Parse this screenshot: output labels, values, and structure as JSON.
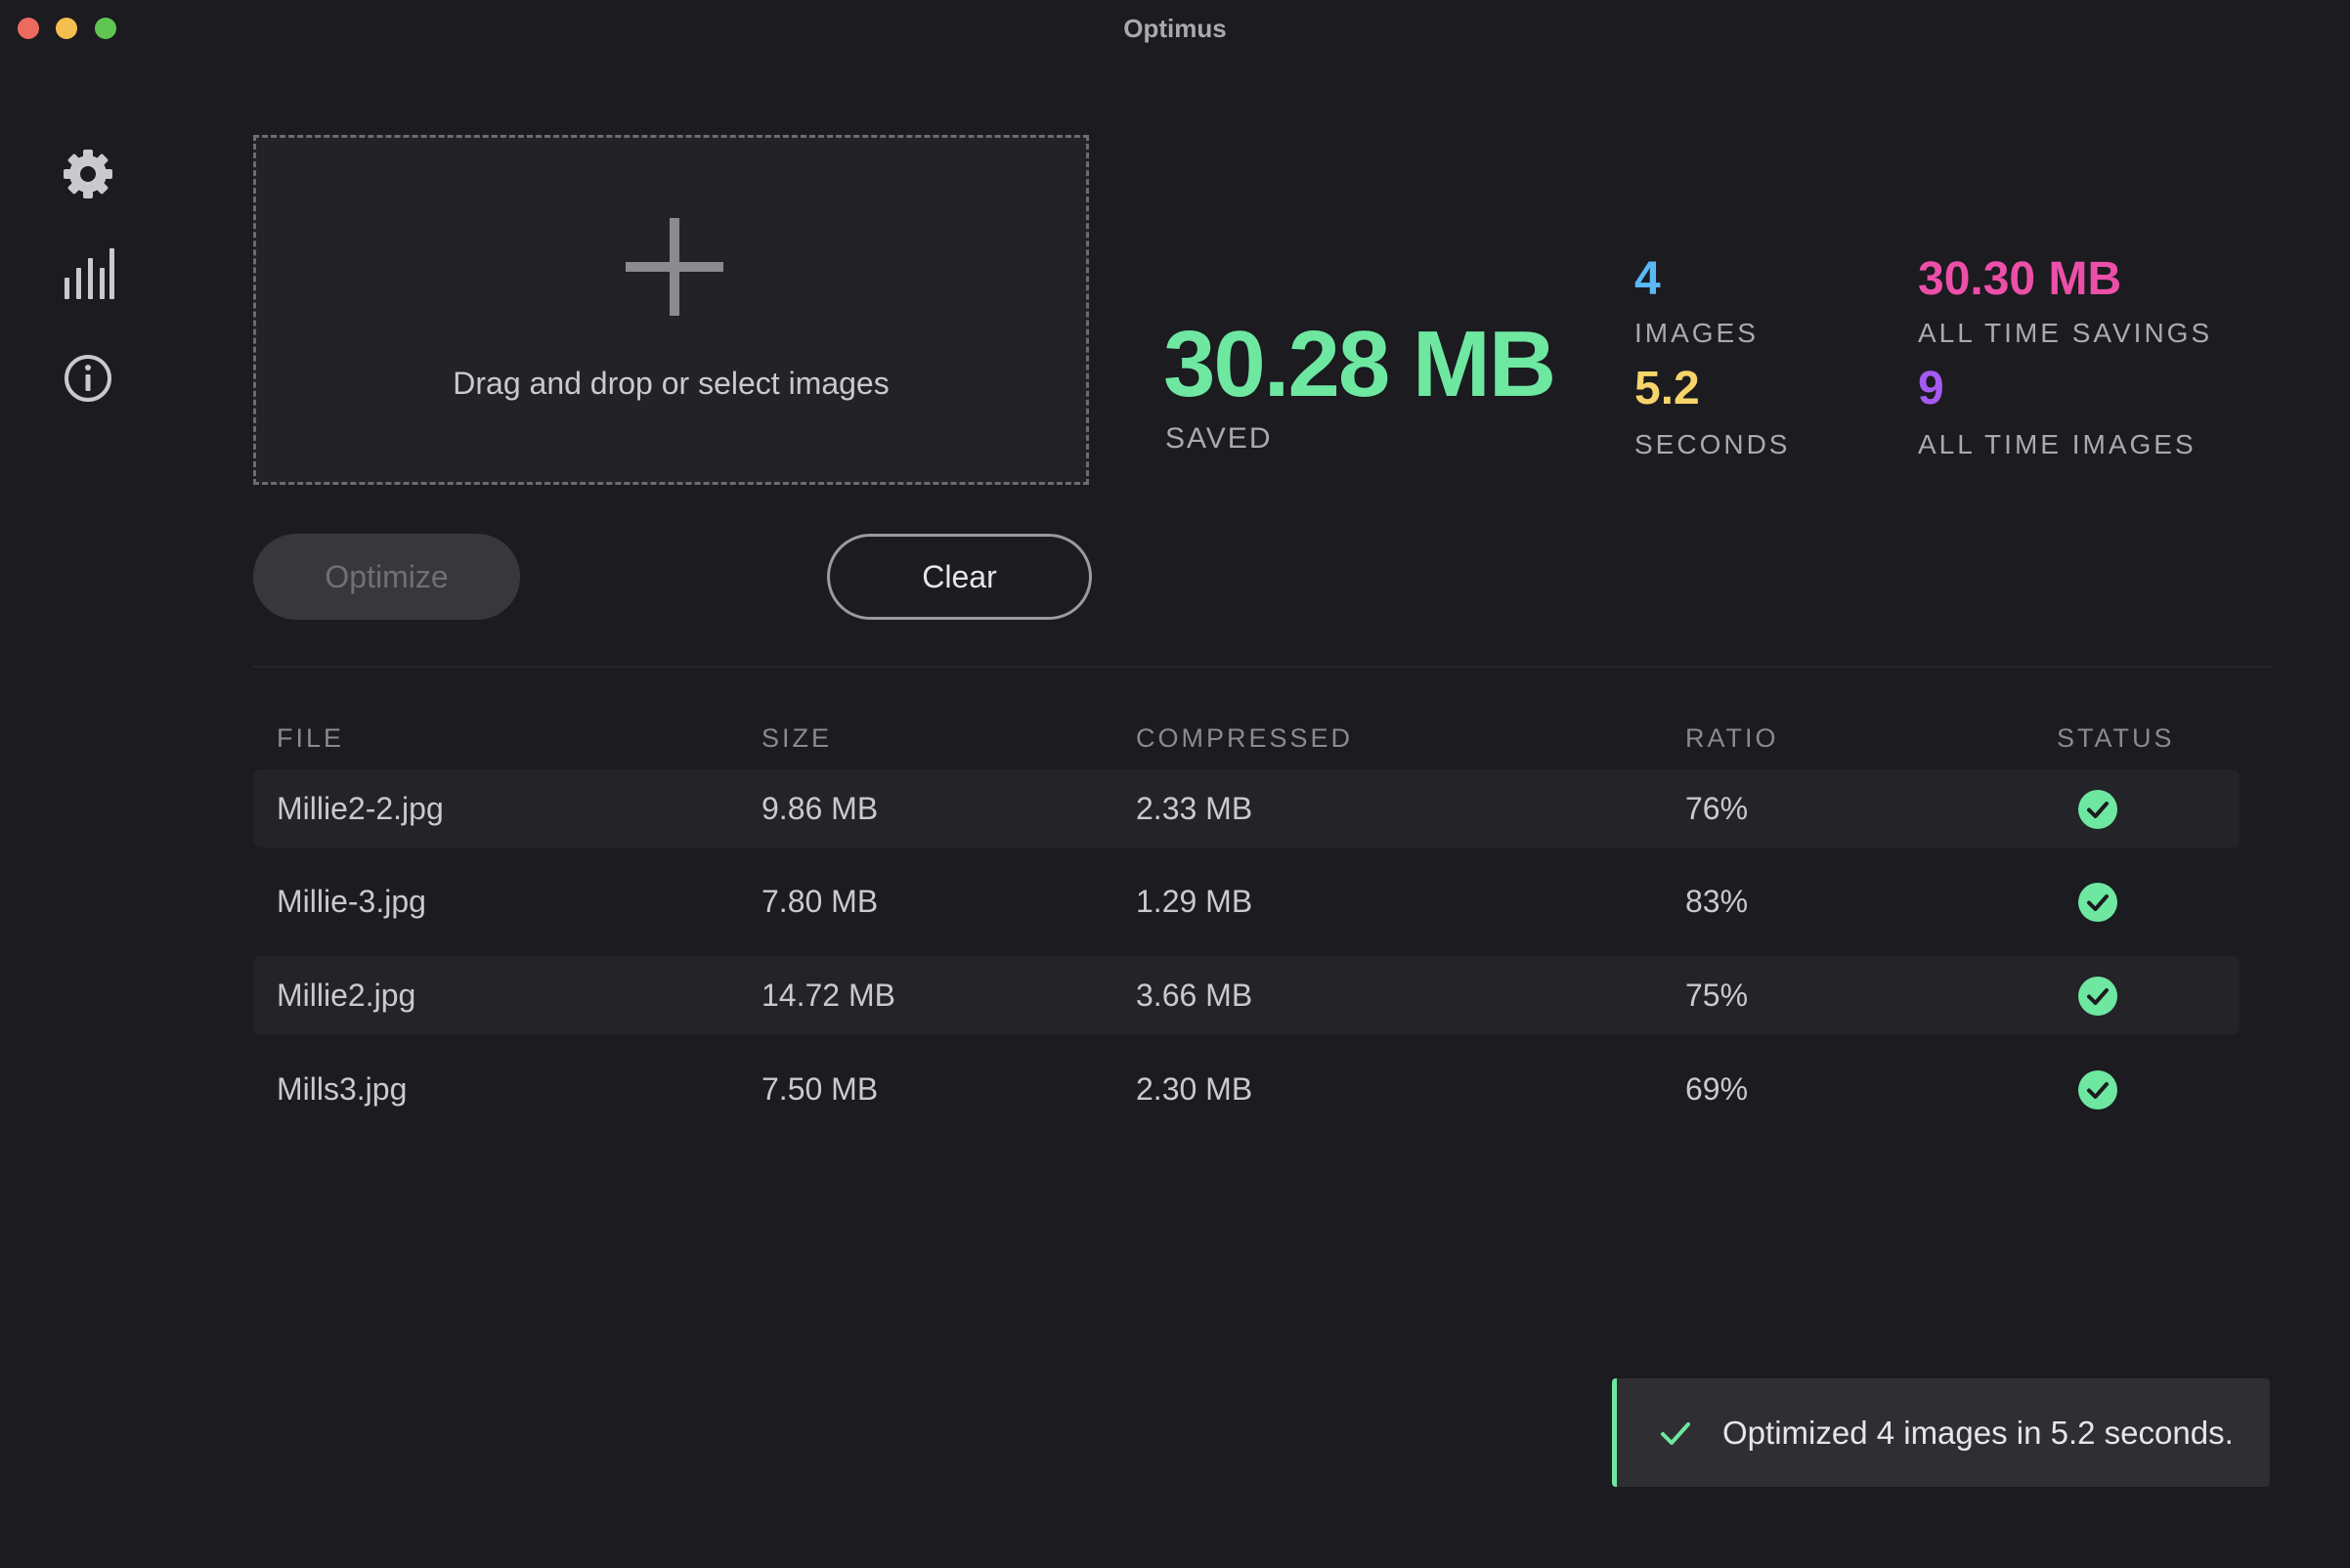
{
  "window": {
    "title": "Optimus"
  },
  "sidebar": {
    "items": [
      {
        "name": "settings",
        "icon": "gear-icon"
      },
      {
        "name": "stats",
        "icon": "bar-chart-icon"
      },
      {
        "name": "about",
        "icon": "info-icon"
      }
    ]
  },
  "dropzone": {
    "text": "Drag and drop or select images"
  },
  "actions": {
    "optimize_label": "Optimize",
    "clear_label": "Clear"
  },
  "stats": {
    "saved_value": "30.28 MB",
    "saved_label": "SAVED",
    "images_value": "4",
    "images_label": "IMAGES",
    "seconds_value": "5.2",
    "seconds_label": "SECONDS",
    "all_time_savings_value": "30.30 MB",
    "all_time_savings_label": "ALL TIME SAVINGS",
    "all_time_images_value": "9",
    "all_time_images_label": "ALL TIME IMAGES"
  },
  "colors": {
    "saved": "#6ee7a1",
    "images": "#5ab8f5",
    "seconds": "#f7d46a",
    "all_time_savings": "#ec4fa8",
    "all_time_images": "#a55af2",
    "status_ok": "#6ee7a1"
  },
  "table": {
    "headers": {
      "file": "FILE",
      "size": "SIZE",
      "compressed": "COMPRESSED",
      "ratio": "RATIO",
      "status": "STATUS"
    },
    "rows": [
      {
        "file": "Millie2-2.jpg",
        "size": "9.86 MB",
        "compressed": "2.33 MB",
        "ratio": "76%",
        "status": "check-circle-icon"
      },
      {
        "file": "Millie-3.jpg",
        "size": "7.80 MB",
        "compressed": "1.29 MB",
        "ratio": "83%",
        "status": "check-circle-icon"
      },
      {
        "file": "Millie2.jpg",
        "size": "14.72 MB",
        "compressed": "3.66 MB",
        "ratio": "75%",
        "status": "check-circle-icon"
      },
      {
        "file": "Mills3.jpg",
        "size": "7.50 MB",
        "compressed": "2.30 MB",
        "ratio": "69%",
        "status": "check-circle-icon"
      }
    ]
  },
  "toast": {
    "message": "Optimized 4 images in 5.2 seconds.",
    "icon": "check-icon"
  }
}
